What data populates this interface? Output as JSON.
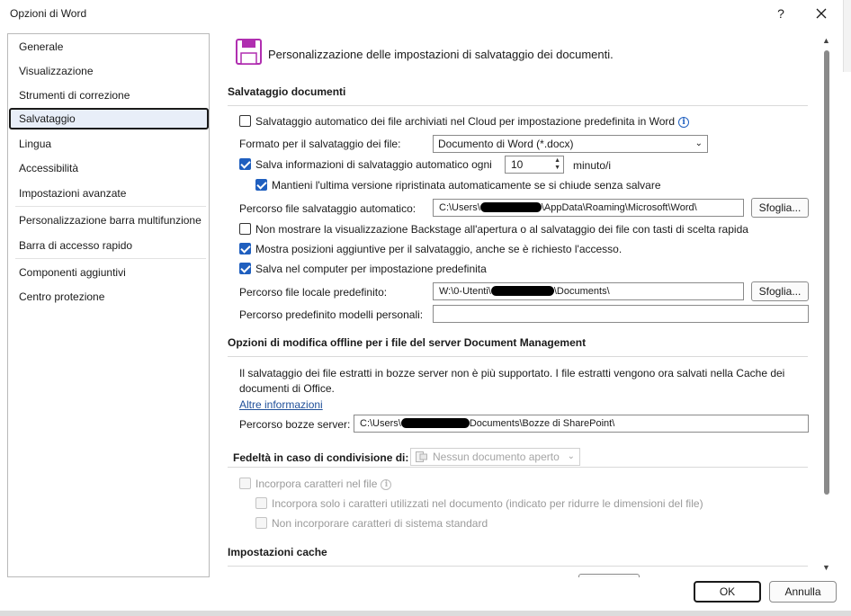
{
  "window": {
    "title": "Opzioni di Word",
    "help_label": "?"
  },
  "sidebar": {
    "items": [
      {
        "label": "Generale"
      },
      {
        "label": "Visualizzazione"
      },
      {
        "label": "Strumenti di correzione"
      },
      {
        "label": "Salvataggio",
        "selected": true
      },
      {
        "label": "Lingua"
      },
      {
        "label": "Accessibilità"
      },
      {
        "label": "Impostazioni avanzate"
      },
      {
        "label": "Personalizzazione barra multifunzione"
      },
      {
        "label": "Barra di accesso rapido"
      },
      {
        "label": "Componenti aggiuntivi"
      },
      {
        "label": "Centro protezione"
      }
    ]
  },
  "main": {
    "header": "Personalizzazione delle impostazioni di salvataggio dei documenti.",
    "save_section": {
      "title": "Salvataggio documenti",
      "autosave_cloud": {
        "label": "Salvataggio automatico dei file archiviati nel Cloud per impostazione predefinita in Word",
        "checked": false
      },
      "format_label": "Formato per il salvataggio dei file:",
      "format_value": "Documento di Word (*.docx)",
      "autorecover": {
        "label": "Salva informazioni di salvataggio automatico ogni",
        "checked": true,
        "minutes": "10",
        "unit": "minuto/i"
      },
      "keep_last": {
        "label": "Mantieni l'ultima versione ripristinata automaticamente se si chiude senza salvare",
        "checked": true
      },
      "autorecover_path_label": "Percorso file salvataggio automatico:",
      "autorecover_path_prefix": "C:\\Users\\",
      "autorecover_path_suffix": "\\AppData\\Roaming\\Microsoft\\Word\\",
      "browse1": "Sfoglia...",
      "no_backstage": {
        "label": "Non mostrare la visualizzazione Backstage all'apertura o al salvataggio dei file con tasti di scelta rapida",
        "checked": false
      },
      "show_locations": {
        "label": "Mostra posizioni aggiuntive per il salvataggio, anche se è richiesto l'accesso.",
        "checked": true
      },
      "save_computer": {
        "label": "Salva nel computer per impostazione predefinita",
        "checked": true
      },
      "local_path_label": "Percorso file locale predefinito:",
      "local_path_prefix": "W:\\0-Utenti\\",
      "local_path_suffix": "\\Documents\\",
      "browse2": "Sfoglia...",
      "templates_label": "Percorso predefinito modelli personali:",
      "templates_value": ""
    },
    "offline_section": {
      "title": "Opzioni di modifica offline per i file del server Document Management",
      "description": "Il salvataggio dei file estratti in bozze server non è più supportato. I file estratti vengono ora salvati nella Cache dei documenti di Office.",
      "more_info": "Altre informazioni",
      "drafts_label": "Percorso bozze server:",
      "drafts_prefix": "C:\\Users\\",
      "drafts_suffix": "Documents\\Bozze di SharePoint\\"
    },
    "fidelity_section": {
      "title": "Fedeltà in caso di condivisione di:",
      "document_select": "Nessun documento aperto",
      "embed_fonts": {
        "label": "Incorpora caratteri nel file",
        "checked": false
      },
      "embed_used": {
        "label": "Incorpora solo i caratteri utilizzati nel documento (indicato per ridurre le dimensioni del file)",
        "checked": false
      },
      "no_system": {
        "label": "Non incorporare caratteri di sistema standard",
        "checked": false
      }
    },
    "cache_section": {
      "title": "Impostazioni cache"
    }
  },
  "footer": {
    "ok": "OK",
    "cancel": "Annulla"
  },
  "colors": {
    "accent": "#1f5fbf",
    "selected_bg": "#e8eef8",
    "icon_purple": "#b02fb0"
  }
}
